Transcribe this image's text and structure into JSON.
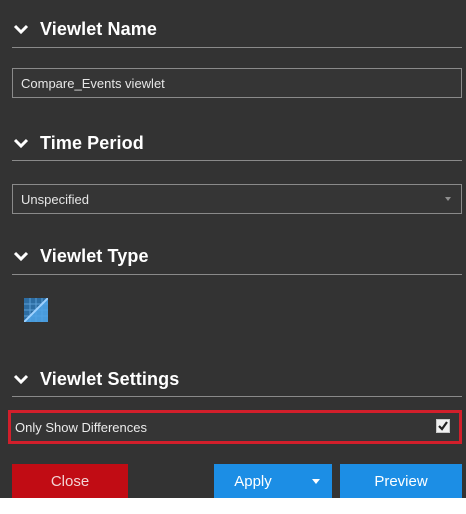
{
  "sections": {
    "viewlet_name": {
      "title": "Viewlet Name",
      "input_value": "Compare_Events viewlet"
    },
    "time_period": {
      "title": "Time Period",
      "selected_value": "Unspecified"
    },
    "viewlet_type": {
      "title": "Viewlet Type",
      "selected_icon": "grid-diagonal-icon"
    },
    "viewlet_settings": {
      "title": "Viewlet Settings",
      "only_show_differences_label": "Only Show Differences",
      "only_show_differences_checked": true
    }
  },
  "buttons": {
    "close_label": "Close",
    "apply_label": "Apply",
    "preview_label": "Preview"
  },
  "colors": {
    "panel_background": "#333333",
    "close_button": "#c10c14",
    "primary_button": "#1c8ee5",
    "highlight_border": "#d21f2b"
  }
}
